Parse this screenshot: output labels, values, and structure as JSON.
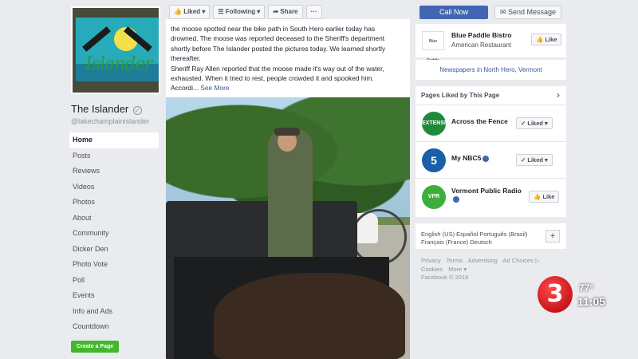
{
  "cover": {
    "logo_text": "Islander"
  },
  "page": {
    "name": "The Islander",
    "handle": "@lakechamplainislander",
    "verified_mark": "✓"
  },
  "nav": {
    "items": [
      "Home",
      "Posts",
      "Reviews",
      "Videos",
      "Photos",
      "About",
      "Community",
      "Dicker Den",
      "Photo Vote",
      "Poll",
      "Events",
      "Info and Ads",
      "Countdown"
    ],
    "active": "Home",
    "create_page": "Create a Page"
  },
  "actions": {
    "liked": "Liked",
    "following": "Following",
    "share": "Share",
    "more": "···"
  },
  "post": {
    "line1": "the moose spotted near the bike path in South Hero earlier today has",
    "line2": "drowned. The moose was reported deceased to the Sheriff's department",
    "line3": "shortly before The Islander posted the pictures today. We learned shortly",
    "line4": "thereafter.",
    "line5": "Sheriff Ray Allen reported that the moose made it's way out of the water,",
    "line6": "exhausted. When it tried to rest, people crowded it and spooked him.",
    "line7": "Accordi...",
    "see_more": "See More"
  },
  "sidebar": {
    "call_now": "Call Now",
    "send_message": "Send Message",
    "bistro": {
      "logo": "Blue Paddle",
      "name": "Blue Paddle Bistro",
      "category": "American Restaurant",
      "like": "Like"
    },
    "newspapers": "Newspapers in North Hero, Vermont",
    "pages_liked": {
      "header": "Pages Liked by This Page",
      "items": [
        {
          "name": "Across the Fence",
          "button": "Liked",
          "avatar": "EXTENSION"
        },
        {
          "name": "My NBC5",
          "button": "Liked",
          "avatar": "5"
        },
        {
          "name": "Vermont Public Radio",
          "button": "Like",
          "avatar": "VPR"
        }
      ]
    },
    "languages": {
      "line1": "English (US)   Español   Português (Brasil)",
      "line2": "Français (France)   Deutsch",
      "plus": "+"
    },
    "footer": {
      "links": [
        "Privacy",
        "Terms",
        "Advertising",
        "Ad Choices ▷",
        "Cookies",
        "More ▾"
      ],
      "copyright": "Facebook © 2018"
    }
  },
  "station_bug": {
    "logo": "3",
    "temp": "77°",
    "time": "11:05"
  }
}
